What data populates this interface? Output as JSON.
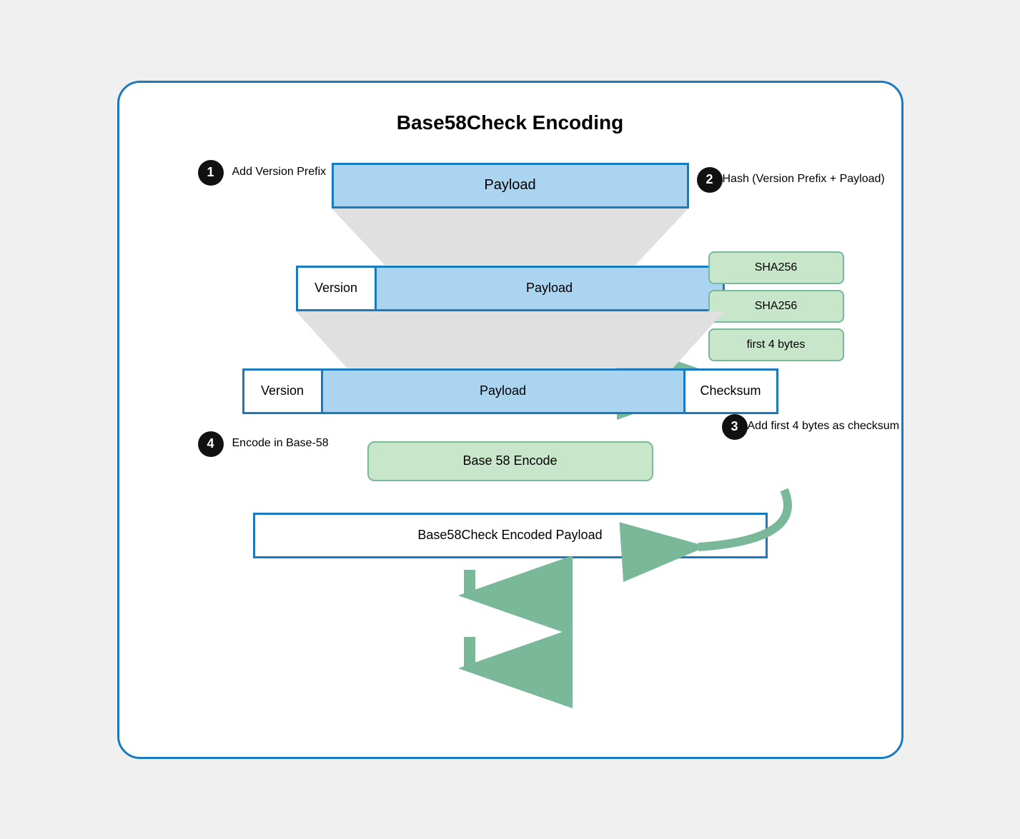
{
  "title": "Base58Check Encoding",
  "steps": [
    {
      "number": "1",
      "label": "Add Version Prefix"
    },
    {
      "number": "2",
      "label": "Hash (Version Prefix + Payload)"
    },
    {
      "number": "3",
      "label": "Add first 4 bytes as checksum"
    },
    {
      "number": "4",
      "label": "Encode in Base-58"
    }
  ],
  "boxes": {
    "payload": "Payload",
    "version": "Version",
    "checksum": "Checksum",
    "sha256_1": "SHA256",
    "sha256_2": "SHA256",
    "first4bytes": "first 4 bytes",
    "base58encode": "Base 58 Encode",
    "finalPayload": "Base58Check Encoded Payload"
  },
  "colors": {
    "blue_border": "#1a7abf",
    "blue_fill": "#aad4f0",
    "green_border": "#7ab89a",
    "green_fill": "#c8e6c9",
    "gray_funnel": "#e0e0e0",
    "badge_bg": "#111111"
  }
}
